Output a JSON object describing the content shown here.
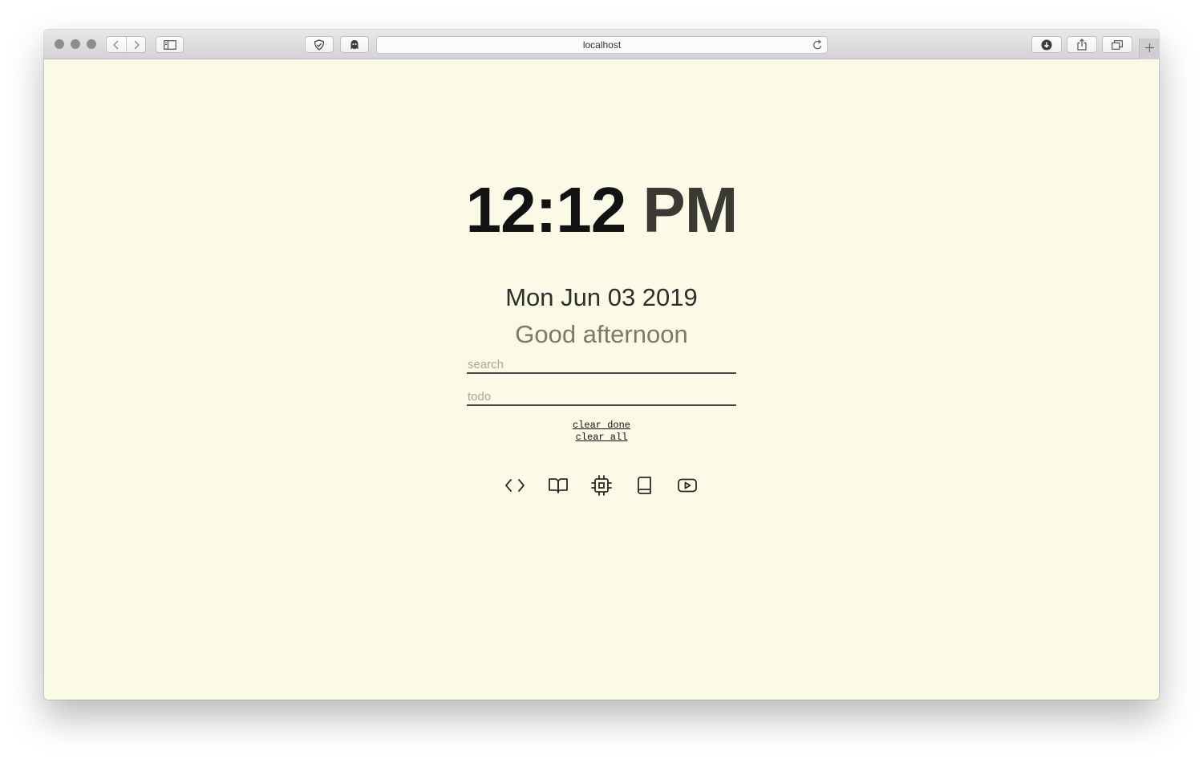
{
  "browser": {
    "url": "localhost",
    "toolbar_icons": [
      "back-icon",
      "forward-icon",
      "sidebar-icon",
      "shield-icon",
      "ghostery-icon",
      "reload-icon",
      "download-icon",
      "share-icon",
      "tabs-overview-icon",
      "new-tab-icon"
    ]
  },
  "page": {
    "background_color": "#fafae6",
    "clock": {
      "time": "12:12",
      "ampm": "PM"
    },
    "date": "Mon Jun 03 2019",
    "greeting": "Good afternoon",
    "search": {
      "placeholder": "search",
      "value": ""
    },
    "todo": {
      "placeholder": "todo",
      "value": ""
    },
    "actions": {
      "clear_done": "clear done",
      "clear_all": "clear all"
    },
    "shortcuts": [
      "code-icon",
      "open-book-icon",
      "cpu-icon",
      "book-icon",
      "youtube-icon"
    ]
  }
}
